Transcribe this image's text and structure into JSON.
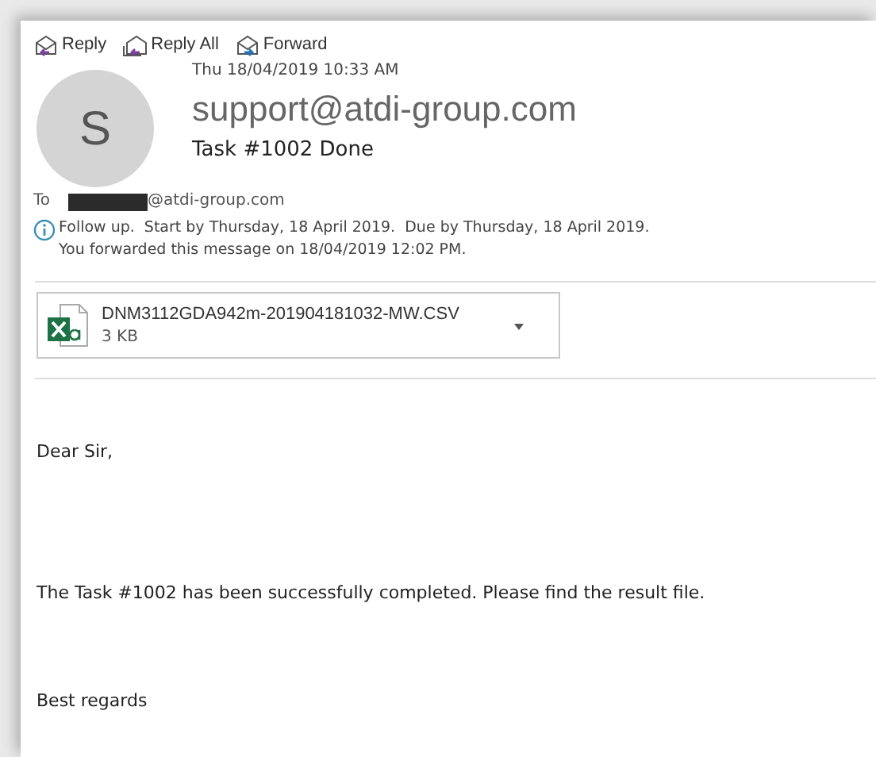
{
  "toolbar": [
    {
      "kind": "reply",
      "label": "Reply"
    },
    {
      "kind": "reply_all",
      "label": "Reply All"
    },
    {
      "kind": "forward",
      "label": "Forward"
    }
  ],
  "message": {
    "avatar_letter": "S",
    "date": "Thu 18/04/2019 10:33 AM",
    "sender": "support@atdi-group.com",
    "subject": "Task #1002 Done",
    "to_label": "To",
    "to_address": "@atdi-group.com",
    "info": [
      "Follow up.  Start by Thursday, 18 April 2019.  Due by Thursday, 18 April 2019.",
      "You forwarded this message on 18/04/2019 12:02 PM."
    ]
  },
  "attachment": {
    "name": "DNM3112GDA942m-201904181032-MW.CSV",
    "size": "3 KB"
  },
  "body": [
    "Dear Sir,",
    "The Task #1002 has been successfully completed. Please find the result file.",
    "Best regards"
  ]
}
